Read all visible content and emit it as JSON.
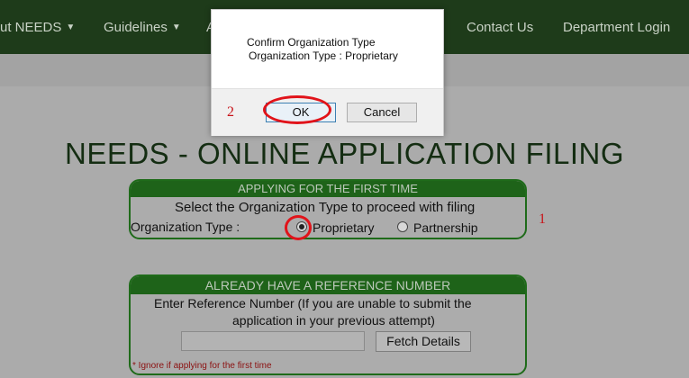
{
  "nav": {
    "items": [
      {
        "label": "ut NEEDS",
        "has_dropdown": true
      },
      {
        "label": "Guidelines",
        "has_dropdown": true
      },
      {
        "label": "A",
        "has_dropdown": false
      },
      {
        "label": "Contact Us",
        "has_dropdown": false
      },
      {
        "label": "Department Login",
        "has_dropdown": false
      }
    ]
  },
  "page": {
    "title": "NEEDS - ONLINE APPLICATION FILING"
  },
  "first_time": {
    "header": "APPLYING FOR THE FIRST TIME",
    "instruction": "Select the Organization Type to proceed with filing",
    "org_type_label": "Organization Type :",
    "options": [
      {
        "label": "Proprietary",
        "selected": true
      },
      {
        "label": "Partnership",
        "selected": false
      }
    ]
  },
  "reference": {
    "header": "ALREADY HAVE A REFERENCE NUMBER",
    "instruction_line1": "Enter Reference Number (If you are unable to submit the",
    "instruction_line2": "application in your previous attempt)",
    "input_value": "",
    "fetch_label": "Fetch Details",
    "note": "* Ignore if applying for the first time"
  },
  "dialog": {
    "title": "Confirm Organization Type",
    "message": "Organization Type : Proprietary",
    "ok_label": "OK",
    "cancel_label": "Cancel"
  },
  "annotations": {
    "step1": "1",
    "step2": "2",
    "color": "#e1131a"
  },
  "colors": {
    "nav_bg": "#1e3b1a",
    "section_header": "#1e6319",
    "title": "#142d12"
  }
}
